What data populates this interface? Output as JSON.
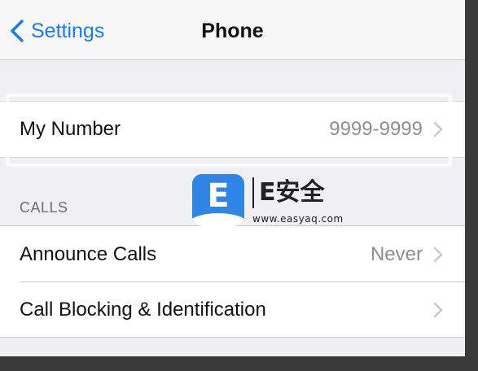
{
  "navbar": {
    "back_label": "Settings",
    "title": "Phone"
  },
  "my_number": {
    "label": "My Number",
    "value": "9999-9999"
  },
  "calls_section": {
    "header": "CALLS",
    "rows": [
      {
        "label": "Announce Calls",
        "value": "Never"
      },
      {
        "label": "Call Blocking & Identification",
        "value": ""
      }
    ]
  },
  "watermark": {
    "icon_letter": "E",
    "title": "E安全",
    "url": "www.easyaq.com"
  },
  "colors": {
    "accent": "#1a7cf5",
    "background": "#efeff4",
    "secondary_text": "#8e8e93"
  }
}
